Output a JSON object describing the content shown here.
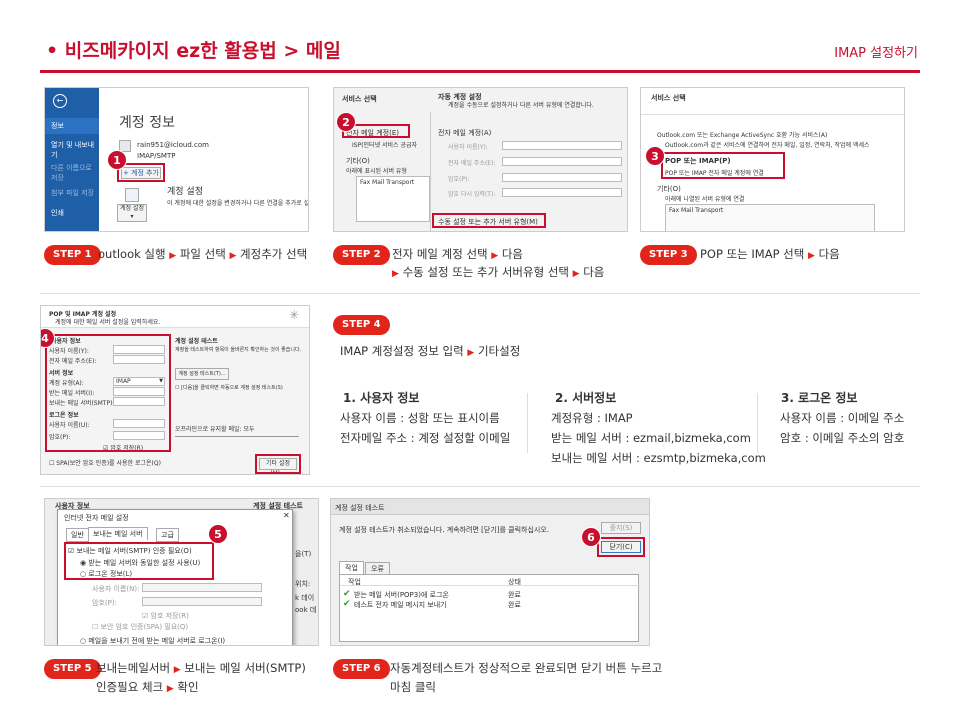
{
  "header": {
    "title": "• 비즈메카이지 ez한 활용법 > 메일",
    "subtitle": "IMAP 설정하기"
  },
  "steps": {
    "s1": {
      "label": "STEP 1",
      "parts": [
        "outlook 실행",
        "파일 선택",
        "계정추가 선택"
      ]
    },
    "s2": {
      "label": "STEP 2",
      "line1": [
        "전자 메일 계정 선택",
        "다음"
      ],
      "line2": [
        "수동 설정 또는 추가 서버유형 선택",
        "다음"
      ]
    },
    "s3": {
      "label": "STEP 3",
      "parts": [
        "POP 또는 IMAP 선택",
        "다음"
      ]
    },
    "s4": {
      "label": "STEP 4",
      "parts": [
        "IMAP 계정설정 정보 입력",
        "기타설정"
      ]
    },
    "s5": {
      "label": "STEP 5",
      "line1": [
        "보내는메일서버",
        "보내는 메일 서버(SMTP)"
      ],
      "line2": [
        "인증필요 체크",
        "확인"
      ]
    },
    "s6": {
      "label": "STEP 6",
      "line1": "자동계정테스트가 정상적으로 완료되면 닫기 버튼 누르고",
      "line2": "마침 클릭"
    }
  },
  "info": {
    "col1": {
      "title": "1.  사용자 정보",
      "lines": [
        "사용자 이름 : 성함 또는 표시이름",
        "전자메일 주소 : 계정 설정할 이메일"
      ]
    },
    "col2": {
      "title": "2. 서버정보",
      "lines": [
        "계정유형 : IMAP",
        "받는 메일 서버   : ezmail,bizmeka,com",
        "보내는 메일 서버 : ezsmtp,bizmeka,com"
      ]
    },
    "col3": {
      "title": "3. 로그온 정보",
      "lines": [
        "사용자 이름 : 이메일 주소",
        "암호 : 이메일 주소의 암호"
      ]
    }
  },
  "shot1": {
    "nav": [
      "정보",
      "열기 및 내보내기",
      "다른 이름으로 저장",
      "첨부 파일 저장",
      "인쇄"
    ],
    "heading": "계정 정보",
    "email": "rain951@icloud.com",
    "type": "IMAP/SMTP",
    "add_button": "+ 계정 추가",
    "settings_title": "계정 설정",
    "settings_desc": "이 계정에 대한 설정을 변경하거나 다른 연결을 추가로 설",
    "settings_btn": "계정 설정 ▾",
    "marker": "1"
  },
  "shot2": {
    "left_header": "서비스 선택",
    "right_header": "자동 계정 설정",
    "right_sub": "계정을 수동으로 설정하거나 다른 서버 유형에 연결합니다.",
    "opt_email": "전자 메일 계정(E)",
    "opt_email_sub": "ISP(인터넷 서비스 공급자",
    "opt_other": "기타(O)",
    "opt_other_sub": "아래에 표시된 서버 유형",
    "fax": "Fax Mail Transport",
    "r_email": "전자 메일 계정(A)",
    "fields": [
      "사용자 이름(Y):",
      "전자 메일 주소(E):",
      "암호(P):",
      "암호 다시 입력(T):"
    ],
    "manual": "수동 설정 또는 추가 서버 유형(M)",
    "marker": "2"
  },
  "shot3": {
    "header": "서비스 선택",
    "opt1": "Outlook.com 또는 Exchange ActiveSync 호환 가능 서비스(A)",
    "opt1_sub": "Outlook.com과 같은 서비스에 연결하여 전자 메일, 일정, 연락처, 작업에 액세스",
    "opt2": "POP 또는 IMAP(P)",
    "opt2_sub": "POP 또는 IMAP 전자 메일 계정에 연결",
    "opt3": "기타(O)",
    "opt3_sub": "아래에 나열된 서버 유형에 연결",
    "fax": "Fax Mail Transport",
    "marker": "3"
  },
  "shot4": {
    "title": "POP 및 IMAP 계정 설정",
    "subtitle": "계정에 대한 메일 서버 설정을 입력하세요.",
    "user_info": "사용자 정보",
    "user_name": "사용자 이름(Y):",
    "email_addr": "전자 메일 주소(E):",
    "server_info": "서버 정보",
    "account_type": "계정 유형(A):",
    "account_type_value": "IMAP",
    "incoming": "받는 메일 서버(I):",
    "outgoing": "보내는 메일 서버(SMTP)(O):",
    "logon": "로그온 정보",
    "logon_user": "사용자 이름(U):",
    "password": "암호(P):",
    "remember": "암호 저장(R)",
    "spa": "SPA(보안 암호 인증)를 사용한 로그온(Q)",
    "test_title": "계정 설정 테스트",
    "test_desc": "계정을 테스트하여 항목이 올바른지 확인하는 것이 좋습니다.",
    "test_btn": "계정 설정 테스트(T)...",
    "auto_test": "[다음]을 클릭하면 자동으로 계정 설정 테스트(S)",
    "offline": "오프라인으로 유지할 메일:  모두",
    "more": "기타 설정(M)...",
    "marker": "4"
  },
  "shot5": {
    "back_header": "사용자 정보",
    "back_right": "계정 설정 테스트",
    "title": "인터넷 전자 메일 설정",
    "tabs": [
      "일반",
      "보내는 메일 서버",
      "고급"
    ],
    "opt_auth": "보내는 메일 서버(SMTP) 인증 필요(O)",
    "opt_same": "받는 메일 서버와 동일한 설정 사용(U)",
    "opt_logon": "로그온 정보(L)",
    "user": "사용자 이름(N):",
    "pw": "암호(P):",
    "save_pw": "암호 저장(R)",
    "spa": "보안 암호 인증(SPA) 필요(Q)",
    "before": "메일을 보내기 전에 받는 메일 서버로 로그온(I)",
    "side": [
      "을(T)",
      "위치:",
      "k 데이",
      "ook 데"
    ],
    "marker": "5"
  },
  "shot6": {
    "title": "계정 설정 테스트",
    "desc": "계정 설정 테스트가 취소되었습니다. 계속하려면 [닫기]를 클릭하십시오.",
    "stop": "중지(S)",
    "close": "닫기(C)",
    "tabs": [
      "작업",
      "오류"
    ],
    "col_task": "작업",
    "col_status": "상태",
    "rows": [
      {
        "task": "받는 메일 서버(POP3)에 로그온",
        "status": "완료"
      },
      {
        "task": "테스트 전자 메일 메시지 보내기",
        "status": "완료"
      }
    ],
    "marker": "6"
  },
  "colors": {
    "accent": "#c8102e",
    "pill": "#e1251b",
    "outlook_blue": "#1f5fa8"
  },
  "icons": [
    "arrow-right-icon",
    "check-icon",
    "back-arrow-icon",
    "wand-icon",
    "avatar-icon",
    "settings-icon"
  ]
}
